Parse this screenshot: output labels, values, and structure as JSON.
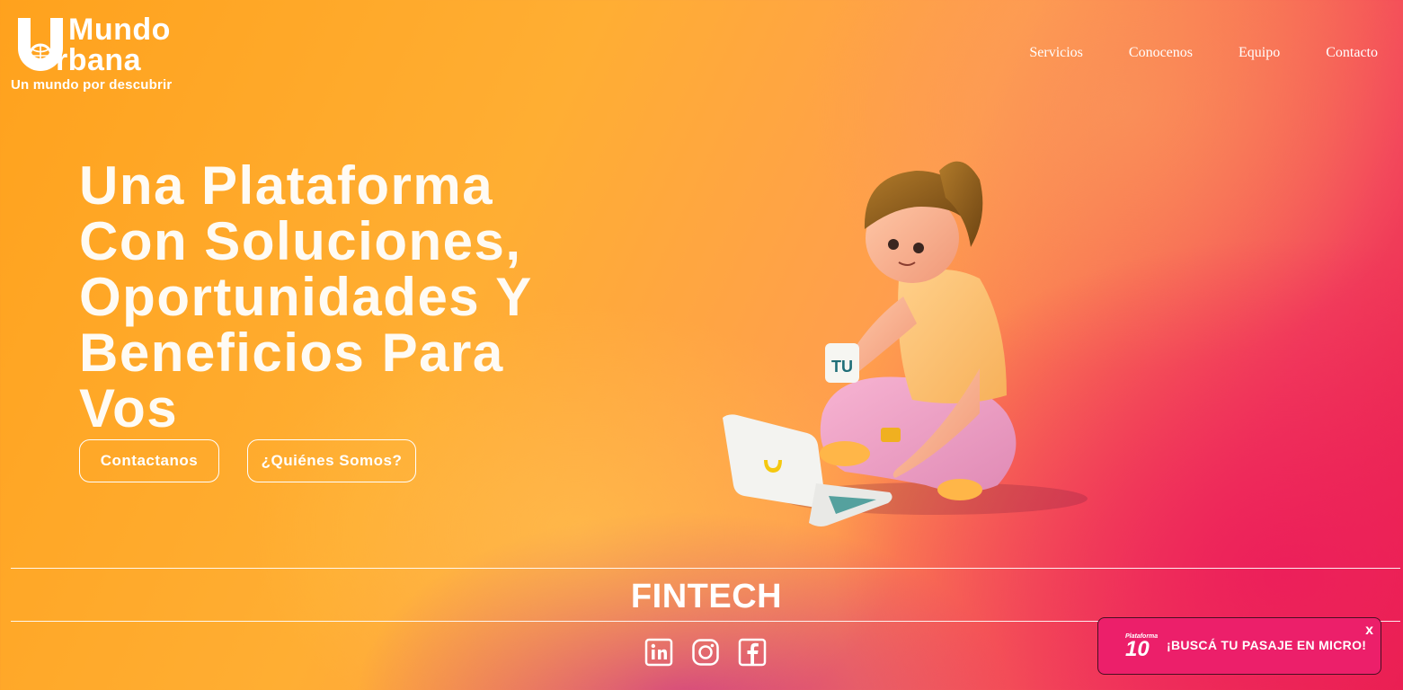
{
  "header": {
    "logo_line1": "Mundo",
    "logo_line2": "rbana",
    "logo_tagline": "Un mundo por descubrir",
    "nav": [
      "Servicios",
      "Conocenos",
      "Equipo",
      "Contacto"
    ]
  },
  "hero": {
    "title_lines": [
      "Una Plataforma",
      "Con Soluciones,",
      "Oportunidades Y",
      "Beneficios Para",
      "Vos"
    ],
    "btn_contact": "Contactanos",
    "btn_about": "¿Quiénes Somos?",
    "mug_text": "TU"
  },
  "band": {
    "title": "FINTECH"
  },
  "social": [
    "linkedin-icon",
    "instagram-icon",
    "facebook-icon"
  ],
  "promo": {
    "brand_small": "Plataforma",
    "brand_big": "10",
    "text": "¡BUSCÁ TU PASAJE EN MICRO!",
    "close": "x"
  },
  "colors": {
    "orange": "#ffa21d",
    "pink": "#ec1f6a",
    "accent_red": "#e8204a",
    "white": "#ffffff"
  }
}
